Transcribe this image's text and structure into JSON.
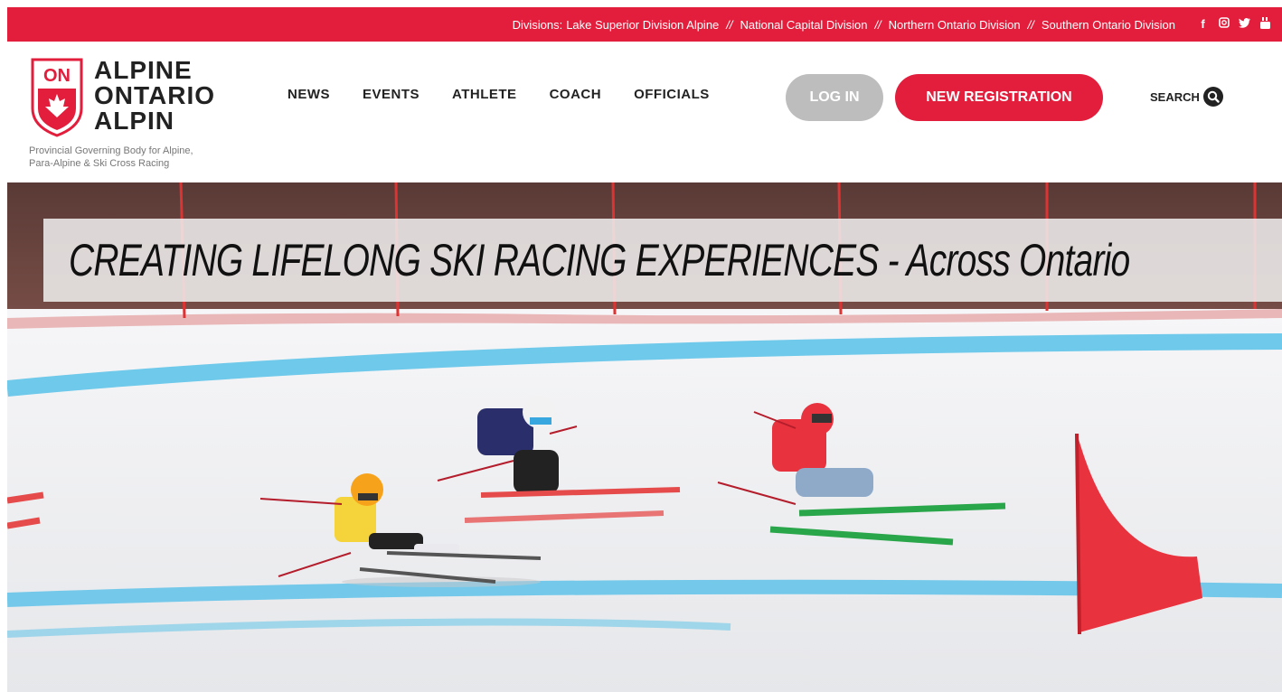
{
  "topbar": {
    "divisions_label": "Divisions:",
    "divisions": [
      "Lake Superior Division Alpine",
      "National Capital Division",
      "Northern Ontario Division",
      "Southern Ontario Division"
    ],
    "separator": "//",
    "social_icons": [
      "facebook-icon",
      "instagram-icon",
      "twitter-icon",
      "youtube-icon"
    ],
    "bg_color": "#e31d3c"
  },
  "logo": {
    "badge": "ON",
    "line1": "ALPINE",
    "line2": "ONTARIO",
    "line3": "ALPIN",
    "tagline1": "Provincial Governing Body for Alpine,",
    "tagline2": "Para-Alpine & Ski Cross Racing"
  },
  "nav": {
    "items": [
      "NEWS",
      "EVENTS",
      "ATHLETE",
      "COACH",
      "OFFICIALS"
    ]
  },
  "buttons": {
    "login": "LOG IN",
    "register": "NEW REGISTRATION"
  },
  "search": {
    "label": "SEARCH"
  },
  "hero": {
    "headline": "CREATING LIFELONG SKI RACING EXPERIENCES - Across Ontario"
  },
  "colors": {
    "brand_red": "#e31d3c",
    "login_gray": "#bdbdbd"
  }
}
